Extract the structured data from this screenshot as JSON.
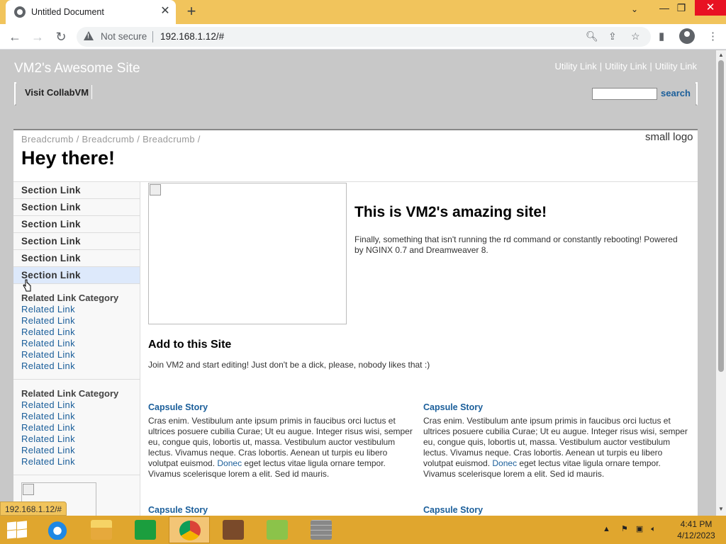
{
  "browser": {
    "tab_title": "Untitled Document",
    "new_tab_label": "+",
    "security_label": "Not secure",
    "url": "192.168.1.12/#",
    "status_url": "192.168.1.12/#"
  },
  "header": {
    "site_title": "VM2's Awesome Site",
    "utility_links": [
      "Utility Link",
      "Utility Link",
      "Utility Link"
    ],
    "utility_sep": "|",
    "nav_link": "Visit CollabVM",
    "search_value": "",
    "search_button": "search"
  },
  "content": {
    "breadcrumb": "Breadcrumb / Breadcrumb / Breadcrumb /",
    "page_title": "Hey there!",
    "small_logo_alt": "small logo"
  },
  "sidebar": {
    "section_links": [
      "Section Link",
      "Section Link",
      "Section Link",
      "Section Link",
      "Section Link",
      "Section Link"
    ],
    "related_groups": [
      {
        "category": "Related Link Category",
        "links": [
          "Related Link",
          "Related Link",
          "Related Link",
          "Related Link",
          "Related Link",
          "Related Link"
        ]
      },
      {
        "category": "Related Link Category",
        "links": [
          "Related Link",
          "Related Link",
          "Related Link",
          "Related Link",
          "Related Link",
          "Related Link"
        ]
      }
    ]
  },
  "main": {
    "hero_title": "This is VM2's amazing site!",
    "hero_text": "Finally, something that isn't running the rd command or constantly rebooting! Powered by NGINX 0.7 and Dreamweaver 8.",
    "add_title": "Add to this Site",
    "add_text": "Join VM2 and start editing! Just don't be a dick, please, nobody likes that :)",
    "capsules": [
      {
        "title": "Capsule Story",
        "text_before": "Cras enim. Vestibulum ante ipsum primis in faucibus orci luctus et ultrices posuere cubilia Curae; Ut eu augue. Integer risus wisi, semper eu, congue quis, lobortis ut, massa. Vestibulum auctor vestibulum lectus. Vivamus neque. Cras lobortis. Aenean ut turpis eu libero volutpat euismod. ",
        "link": "Donec",
        "text_after": " eget lectus vitae ligula ornare tempor. Vivamus scelerisque lorem a elit. Sed id mauris."
      },
      {
        "title": "Capsule Story",
        "text_before": "Cras enim. Vestibulum ante ipsum primis in faucibus orci luctus et ultrices posuere cubilia Curae; Ut eu augue. Integer risus wisi, semper eu, congue quis, lobortis ut, massa. Vestibulum auctor vestibulum lectus. Vivamus neque. Cras lobortis. Aenean ut turpis eu libero volutpat euismod. ",
        "link": "Donec",
        "text_after": " eget lectus vitae ligula ornare tempor. Vivamus scelerisque lorem a elit. Sed id mauris."
      },
      {
        "title": "Capsule Story"
      },
      {
        "title": "Capsule Story"
      }
    ]
  },
  "taskbar": {
    "time": "4:41 PM",
    "date": "4/12/2023",
    "apps": [
      "internet-explorer",
      "file-explorer",
      "store",
      "chrome",
      "photo-viewer",
      "notepad-chart",
      "firewall"
    ]
  },
  "colors": {
    "title_bar": "#f1c45c",
    "taskbar": "#e0a62e",
    "page_bg": "#c8c8c8",
    "link": "#1a5e9a",
    "hover_bg": "#dde9fb"
  }
}
